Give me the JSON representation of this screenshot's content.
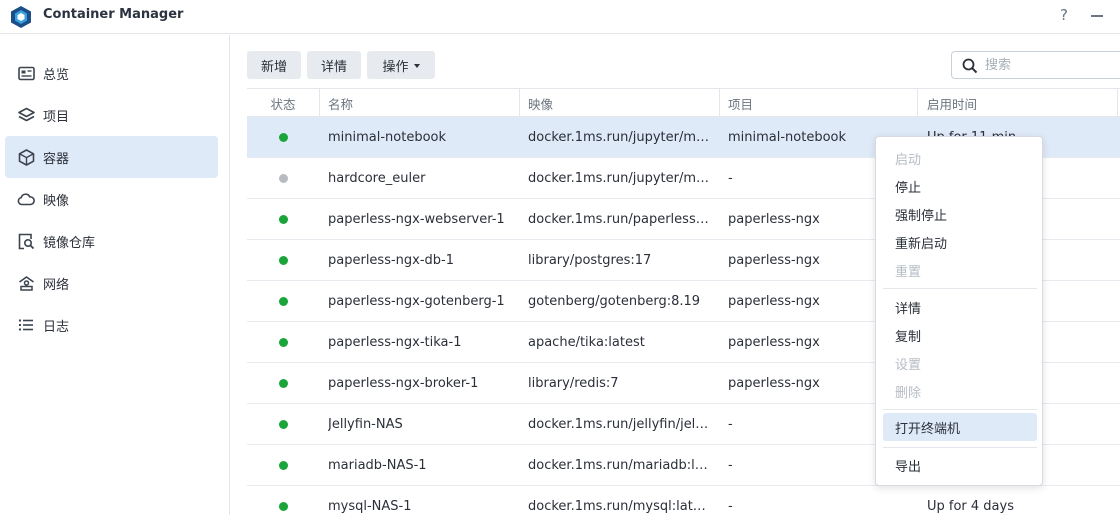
{
  "app": {
    "title": "Container Manager",
    "help_glyph": "?"
  },
  "sidebar": {
    "items": [
      {
        "label": "总览",
        "icon": "overview-icon"
      },
      {
        "label": "项目",
        "icon": "layers-icon"
      },
      {
        "label": "容器",
        "icon": "container-icon",
        "active": true
      },
      {
        "label": "映像",
        "icon": "cloud-icon"
      },
      {
        "label": "镜像仓库",
        "icon": "registry-icon"
      },
      {
        "label": "网络",
        "icon": "network-icon"
      },
      {
        "label": "日志",
        "icon": "list-icon"
      }
    ]
  },
  "toolbar": {
    "add_label": "新增",
    "details_label": "详情",
    "actions_label": "操作"
  },
  "search": {
    "placeholder": "搜索"
  },
  "table": {
    "headers": {
      "status": "状态",
      "name": "名称",
      "image": "映像",
      "project": "项目",
      "uptime": "启用时间"
    },
    "rows": [
      {
        "status": "running",
        "name": "minimal-notebook",
        "image": "docker.1ms.run/jupyter/m…",
        "project": "minimal-notebook",
        "uptime": "Up for 11 min",
        "selected": true
      },
      {
        "status": "stopped",
        "name": "hardcore_euler",
        "image": "docker.1ms.run/jupyter/m…",
        "project": "-",
        "uptime": ""
      },
      {
        "status": "running",
        "name": "paperless-ngx-webserver-1",
        "image": "docker.1ms.run/paperless…",
        "project": "paperless-ngx",
        "uptime": ""
      },
      {
        "status": "running",
        "name": "paperless-ngx-db-1",
        "image": "library/postgres:17",
        "project": "paperless-ngx",
        "uptime": ""
      },
      {
        "status": "running",
        "name": "paperless-ngx-gotenberg-1",
        "image": "gotenberg/gotenberg:8.19",
        "project": "paperless-ngx",
        "uptime": ""
      },
      {
        "status": "running",
        "name": "paperless-ngx-tika-1",
        "image": "apache/tika:latest",
        "project": "paperless-ngx",
        "uptime": ""
      },
      {
        "status": "running",
        "name": "paperless-ngx-broker-1",
        "image": "library/redis:7",
        "project": "paperless-ngx",
        "uptime": ""
      },
      {
        "status": "running",
        "name": "Jellyfin-NAS",
        "image": "docker.1ms.run/jellyfin/jel…",
        "project": "-",
        "uptime": ""
      },
      {
        "status": "running",
        "name": "mariadb-NAS-1",
        "image": "docker.1ms.run/mariadb:l…",
        "project": "-",
        "uptime": ""
      },
      {
        "status": "running",
        "name": "mysql-NAS-1",
        "image": "docker.1ms.run/mysql:lat…",
        "project": "-",
        "uptime": "Up for 4 days"
      }
    ]
  },
  "context_menu": {
    "items": [
      {
        "label": "启动",
        "disabled": true
      },
      {
        "label": "停止"
      },
      {
        "label": "强制停止"
      },
      {
        "label": "重新启动"
      },
      {
        "label": "重置",
        "disabled": true
      },
      {
        "separator": true
      },
      {
        "label": "详情"
      },
      {
        "label": "复制"
      },
      {
        "label": "设置",
        "disabled": true
      },
      {
        "label": "删除",
        "disabled": true
      },
      {
        "separator": true
      },
      {
        "label": "打开终端机",
        "hover": true
      },
      {
        "separator": true
      },
      {
        "label": "导出"
      }
    ]
  },
  "colors": {
    "accent": "#1b8fd2",
    "running": "#1aa53a",
    "stopped": "#b7bcc3",
    "selection": "#dfeaf8"
  }
}
